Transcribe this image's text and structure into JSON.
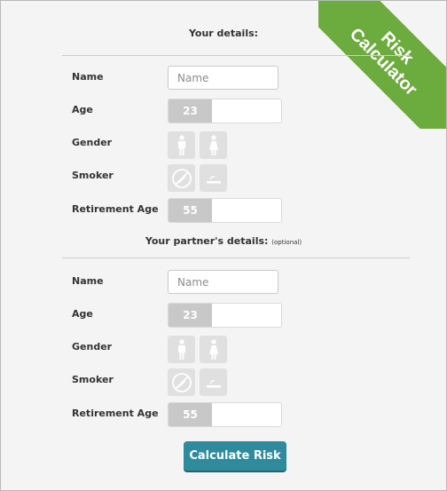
{
  "ribbon": {
    "line1": "Risk",
    "line2": "Calculator",
    "color": "#6cab3d"
  },
  "you": {
    "title": "Your details:",
    "name_label": "Name",
    "name_placeholder": "Name",
    "age_label": "Age",
    "age_value": "23",
    "gender_label": "Gender",
    "smoker_label": "Smoker",
    "retirement_label": "Retirement Age",
    "retirement_value": "55"
  },
  "partner": {
    "title": "Your partner's details:",
    "optional_note": "(optional)",
    "name_label": "Name",
    "name_placeholder": "Name",
    "age_label": "Age",
    "age_value": "23",
    "gender_label": "Gender",
    "smoker_label": "Smoker",
    "retirement_label": "Retirement Age",
    "retirement_value": "55"
  },
  "icons": {
    "male": "male-icon",
    "female": "female-icon",
    "non_smoker": "no-smoking-icon",
    "smoker": "cigarette-icon"
  },
  "calculate_label": "Calculate Risk",
  "colors": {
    "accent": "#2f8b9b",
    "ribbon": "#6cab3d"
  }
}
